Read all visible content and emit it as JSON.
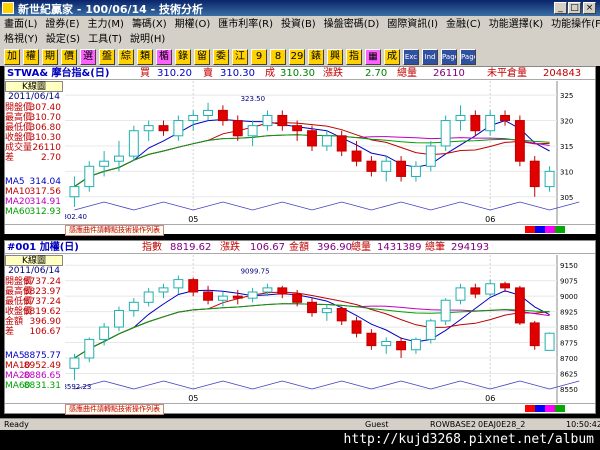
{
  "window": {
    "title": "新世紀贏家 - 100/06/14 - 技術分析"
  },
  "menu": {
    "row1": [
      "畫面(L)",
      "證券(E)",
      "主力(M)",
      "籌碼(X)",
      "期權(O)",
      "匯市利率(R)",
      "投資(B)",
      "操盤密碼(D)",
      "國際資訊(I)",
      "金融(C)",
      "功能選擇(K)",
      "功能操作(F)"
    ],
    "row2": [
      "格視(Y)",
      "設定(S)",
      "工具(T)",
      "說明(H)"
    ]
  },
  "toolbar": {
    "buttons": [
      "加",
      "權",
      "期",
      "價",
      "選",
      "盤",
      "綜",
      "類",
      "楯",
      "錄",
      "留",
      "委",
      "江",
      "9",
      "8",
      "29",
      "錶",
      "興",
      "指",
      "▦",
      "成",
      "Exc",
      "Ind",
      "Page",
      "Page"
    ]
  },
  "panel1": {
    "symbol": "STWA& 摩台指&(日)",
    "buy_label": "買",
    "buy_value": "310.20",
    "sell_label": "賣",
    "sell_value": "310.30",
    "deal_label": "成",
    "deal_value": "310.30",
    "change_label": "漲跌",
    "change_value": "2.70",
    "volume_label": "總量",
    "volume_value": "26110",
    "oi_label": "未平倉量",
    "oi_value": "204843",
    "side": {
      "header": "K線圖",
      "date": "2011/06/14",
      "rows": [
        {
          "label": "開盤價",
          "value": "307.40"
        },
        {
          "label": "最高價",
          "value": "310.70"
        },
        {
          "label": "最低價",
          "value": "306.80"
        },
        {
          "label": "收盤價",
          "value": "310.30"
        },
        {
          "label": "成交量",
          "value": "26110"
        },
        {
          "label": "差",
          "value": "2.70"
        }
      ],
      "ma": [
        {
          "label": "MA5",
          "value": "314.04"
        },
        {
          "label": "MA10",
          "value": "317.56"
        },
        {
          "label": "MA20",
          "value": "314.91"
        },
        {
          "label": "MA60",
          "value": "312.93"
        }
      ]
    },
    "footer_note": "感應曲件請轉點技術操作列表"
  },
  "panel2": {
    "symbol": "#001 加權(日)",
    "index_label": "指數",
    "index_value": "8819.62",
    "change_label": "漲跌",
    "change_value": "106.67",
    "amount_label": "金額",
    "amount_value": "396.90",
    "volume_label": "總量",
    "volume_value": "1431389",
    "trades_label": "總筆",
    "trades_value": "294193",
    "side": {
      "header": "K線圖",
      "date": "2011/06/14",
      "rows": [
        {
          "label": "開盤價",
          "value": "8737.24"
        },
        {
          "label": "最高價",
          "value": "8823.97"
        },
        {
          "label": "最低價",
          "value": "8737.24"
        },
        {
          "label": "收盤價",
          "value": "8819.62"
        },
        {
          "label": "金額",
          "value": "396.90"
        },
        {
          "label": "差",
          "value": "106.67"
        }
      ],
      "ma": [
        {
          "label": "MA5",
          "value": "8875.77"
        },
        {
          "label": "MA10",
          "value": "8952.49"
        },
        {
          "label": "MA20",
          "value": "8886.65"
        },
        {
          "label": "MA60",
          "value": "8831.31"
        }
      ]
    },
    "footer_note": "感應曲件請轉點技術操作列表"
  },
  "chart_data": [
    {
      "type": "candlestick",
      "ylim": [
        302,
        327
      ],
      "yticks": [
        325,
        320,
        315,
        310,
        305
      ],
      "xticks": [
        {
          "index": 8,
          "label": "05"
        },
        {
          "index": 28,
          "label": "06"
        }
      ],
      "annotations": [
        {
          "index": 12,
          "value": 323.5,
          "label": "323.50"
        },
        {
          "index": 0,
          "value": 302.4,
          "label": "302.40"
        }
      ],
      "candles": [
        [
          305,
          309,
          303,
          307
        ],
        [
          307,
          312,
          306,
          311
        ],
        [
          311,
          314,
          309,
          312
        ],
        [
          312,
          316,
          310,
          313
        ],
        [
          313,
          319,
          312,
          318
        ],
        [
          318,
          320,
          316,
          319
        ],
        [
          319,
          320,
          317,
          318
        ],
        [
          317,
          321,
          316,
          320
        ],
        [
          320,
          322,
          318,
          321
        ],
        [
          321,
          323.5,
          320,
          322
        ],
        [
          322,
          323,
          319,
          320
        ],
        [
          320,
          321,
          316,
          317
        ],
        [
          317,
          320,
          315,
          319
        ],
        [
          319,
          322,
          318,
          321
        ],
        [
          321,
          322,
          318,
          319
        ],
        [
          319,
          320,
          316,
          318
        ],
        [
          318,
          319,
          314,
          315
        ],
        [
          315,
          318,
          314,
          317
        ],
        [
          317,
          318,
          313,
          314
        ],
        [
          314,
          316,
          311,
          312
        ],
        [
          312,
          313,
          309,
          310
        ],
        [
          310,
          313,
          308,
          312
        ],
        [
          312,
          313,
          308,
          309
        ],
        [
          309,
          312,
          308,
          311
        ],
        [
          311,
          316,
          310,
          315
        ],
        [
          315,
          321,
          314,
          320
        ],
        [
          320,
          323,
          318,
          321
        ],
        [
          321,
          322,
          317,
          318
        ],
        [
          318,
          322,
          317,
          321
        ],
        [
          321,
          322,
          319,
          320
        ],
        [
          320,
          321,
          311,
          312
        ],
        [
          312,
          313,
          305,
          307
        ],
        [
          307,
          311,
          306,
          310
        ]
      ],
      "ma_colors": {
        "ma5": "#0000c0",
        "ma10": "#c00000",
        "ma20": "#c000c0",
        "ma60": "#00a000"
      }
    },
    {
      "type": "candlestick",
      "ylim": [
        8540,
        9180
      ],
      "yticks": [
        9150,
        9075,
        9000,
        8925,
        8850,
        8775,
        8700,
        8625,
        8550
      ],
      "xticks": [
        {
          "index": 8,
          "label": "05"
        },
        {
          "index": 28,
          "label": "06"
        }
      ],
      "annotations": [
        {
          "index": 12,
          "value": 9099.75,
          "label": "9099.75"
        },
        {
          "index": 0,
          "value": 8592.23,
          "label": "8592.23"
        }
      ],
      "candles": [
        [
          8650,
          8720,
          8592,
          8700
        ],
        [
          8700,
          8800,
          8680,
          8790
        ],
        [
          8790,
          8870,
          8760,
          8850
        ],
        [
          8850,
          8950,
          8830,
          8930
        ],
        [
          8930,
          8990,
          8900,
          8970
        ],
        [
          8970,
          9040,
          8950,
          9020
        ],
        [
          9020,
          9060,
          8990,
          9040
        ],
        [
          9040,
          9099.75,
          9010,
          9080
        ],
        [
          9080,
          9090,
          9000,
          9020
        ],
        [
          9020,
          9050,
          8960,
          8980
        ],
        [
          8980,
          9020,
          8950,
          9000
        ],
        [
          9000,
          9030,
          8960,
          8990
        ],
        [
          8990,
          9040,
          8970,
          9020
        ],
        [
          9020,
          9060,
          9000,
          9040
        ],
        [
          9040,
          9050,
          8990,
          9010
        ],
        [
          9010,
          9030,
          8950,
          8970
        ],
        [
          8970,
          8990,
          8900,
          8920
        ],
        [
          8920,
          8960,
          8880,
          8940
        ],
        [
          8940,
          8950,
          8860,
          8880
        ],
        [
          8880,
          8900,
          8800,
          8820
        ],
        [
          8820,
          8840,
          8740,
          8760
        ],
        [
          8760,
          8800,
          8720,
          8780
        ],
        [
          8780,
          8800,
          8700,
          8740
        ],
        [
          8740,
          8800,
          8720,
          8790
        ],
        [
          8790,
          8890,
          8770,
          8880
        ],
        [
          8880,
          8990,
          8860,
          8980
        ],
        [
          8980,
          9060,
          8960,
          9040
        ],
        [
          9040,
          9060,
          8990,
          9010
        ],
        [
          9010,
          9080,
          9000,
          9060
        ],
        [
          9060,
          9070,
          9020,
          9040
        ],
        [
          9040,
          9050,
          8860,
          8870
        ],
        [
          8870,
          8880,
          8740,
          8760
        ],
        [
          8737,
          8824,
          8737,
          8820
        ]
      ],
      "ma_colors": {
        "ma5": "#0000c0",
        "ma10": "#c00000",
        "ma20": "#c000c0",
        "ma60": "#00a000"
      }
    }
  ],
  "statusbar": {
    "ready": "Ready",
    "guest": "Guest",
    "host": "ROWBASE2",
    "code": "0EAJ0E28_2",
    "time": "10:50:42"
  },
  "watermark": "http://kujd3268.pixnet.net/album"
}
